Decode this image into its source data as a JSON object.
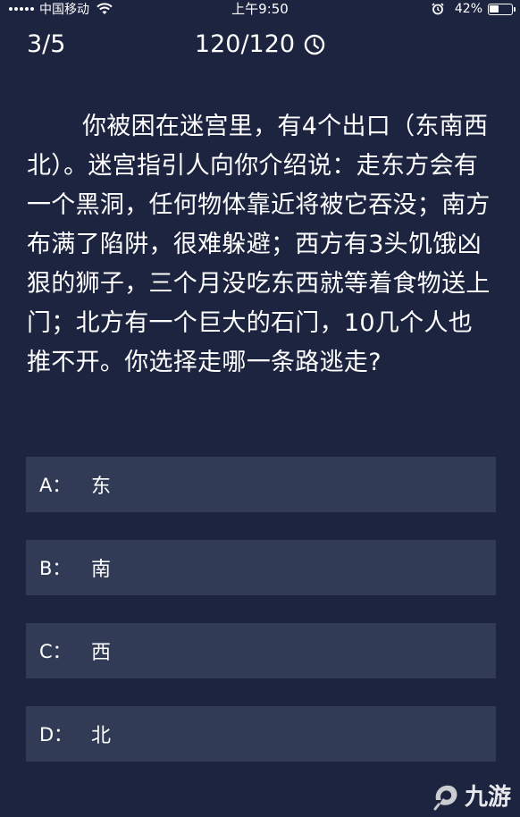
{
  "status_bar": {
    "carrier": "中国移动",
    "time": "上午9:50",
    "battery": "42%",
    "battery_level": 0.42,
    "icons": [
      "signal-icon",
      "wifi-icon",
      "alarm-icon",
      "battery-icon"
    ]
  },
  "header": {
    "progress": "3/5",
    "timer": "120/120",
    "timer_icon": "clock-icon"
  },
  "question": {
    "text": "你被困在迷宫里，有4个出口（东南西北）。迷宫指引人向你介绍说：走东方会有一个黑洞，任何物体靠近将被它吞没；南方布满了陷阱，很难躲避；西方有3头饥饿凶狠的狮子，三个月没吃东西就等着食物送上门；北方有一个巨大的石门，10几个人也推不开。你选择走哪一条路逃走?"
  },
  "options": [
    {
      "letter": "A：",
      "text": "东"
    },
    {
      "letter": "B：",
      "text": "南"
    },
    {
      "letter": "C：",
      "text": "西"
    },
    {
      "letter": "D：",
      "text": "北"
    }
  ],
  "watermark": {
    "text": "九游",
    "icon": "jiuyou-logo-icon"
  },
  "colors": {
    "background": "#1c2440",
    "option_bg": "#313b55",
    "text": "#ffffff"
  }
}
